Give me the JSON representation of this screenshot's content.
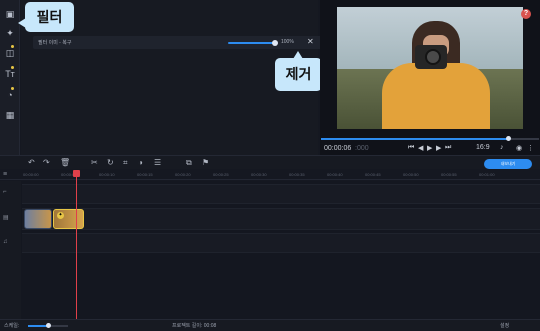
{
  "callouts": {
    "filter": "필터",
    "remove": "제거"
  },
  "filter_item": {
    "name": "필터 이미 - 복구",
    "value": "100%",
    "level": 0.92
  },
  "preview": {
    "current_time": "00:00:06",
    "frame_dim": ":000",
    "aspect": "16:9",
    "progress": 0.86
  },
  "toolbar": {
    "export_label": "내보내기"
  },
  "ruler": [
    "00:00:00",
    "00:00:05",
    "00:00:10",
    "00:00:15",
    "00:00:20",
    "00:00:25",
    "00:00:30",
    "00:00:35",
    "00:00:40",
    "00:00:45",
    "00:00:50",
    "00:00:55",
    "00:01:00"
  ],
  "status": {
    "scale_label": "스케일:",
    "project_length": "프로젝트 길이:  00:08",
    "settings": "설정"
  },
  "colors": {
    "accent": "#2d8cf0",
    "playhead": "#e0404a",
    "callout": "#c7e7fb"
  }
}
